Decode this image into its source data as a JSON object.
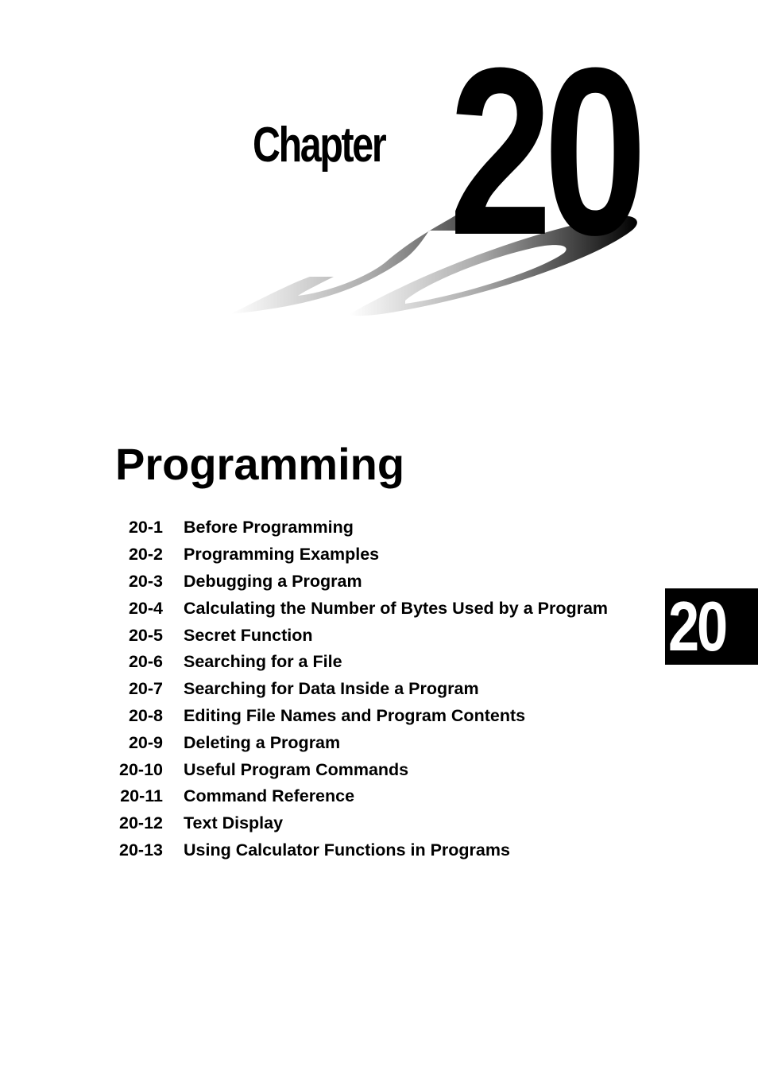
{
  "header": {
    "chapter_word": "Chapter",
    "chapter_number": "20"
  },
  "title": "Programming",
  "toc": [
    {
      "num": "20-1",
      "label": "Before Programming"
    },
    {
      "num": "20-2",
      "label": "Programming Examples"
    },
    {
      "num": "20-3",
      "label": "Debugging a Program"
    },
    {
      "num": "20-4",
      "label": "Calculating the Number of Bytes Used by a Program"
    },
    {
      "num": "20-5",
      "label": "Secret Function"
    },
    {
      "num": "20-6",
      "label": "Searching for a File"
    },
    {
      "num": "20-7",
      "label": "Searching for Data Inside a Program"
    },
    {
      "num": "20-8",
      "label": "Editing File Names and Program Contents"
    },
    {
      "num": "20-9",
      "label": "Deleting a Program"
    },
    {
      "num": "20-10",
      "label": "Useful Program Commands"
    },
    {
      "num": "20-11",
      "label": "Command Reference"
    },
    {
      "num": "20-12",
      "label": "Text Display"
    },
    {
      "num": "20-13",
      "label": "Using Calculator Functions in Programs"
    }
  ],
  "side_tab": {
    "number": "20"
  }
}
